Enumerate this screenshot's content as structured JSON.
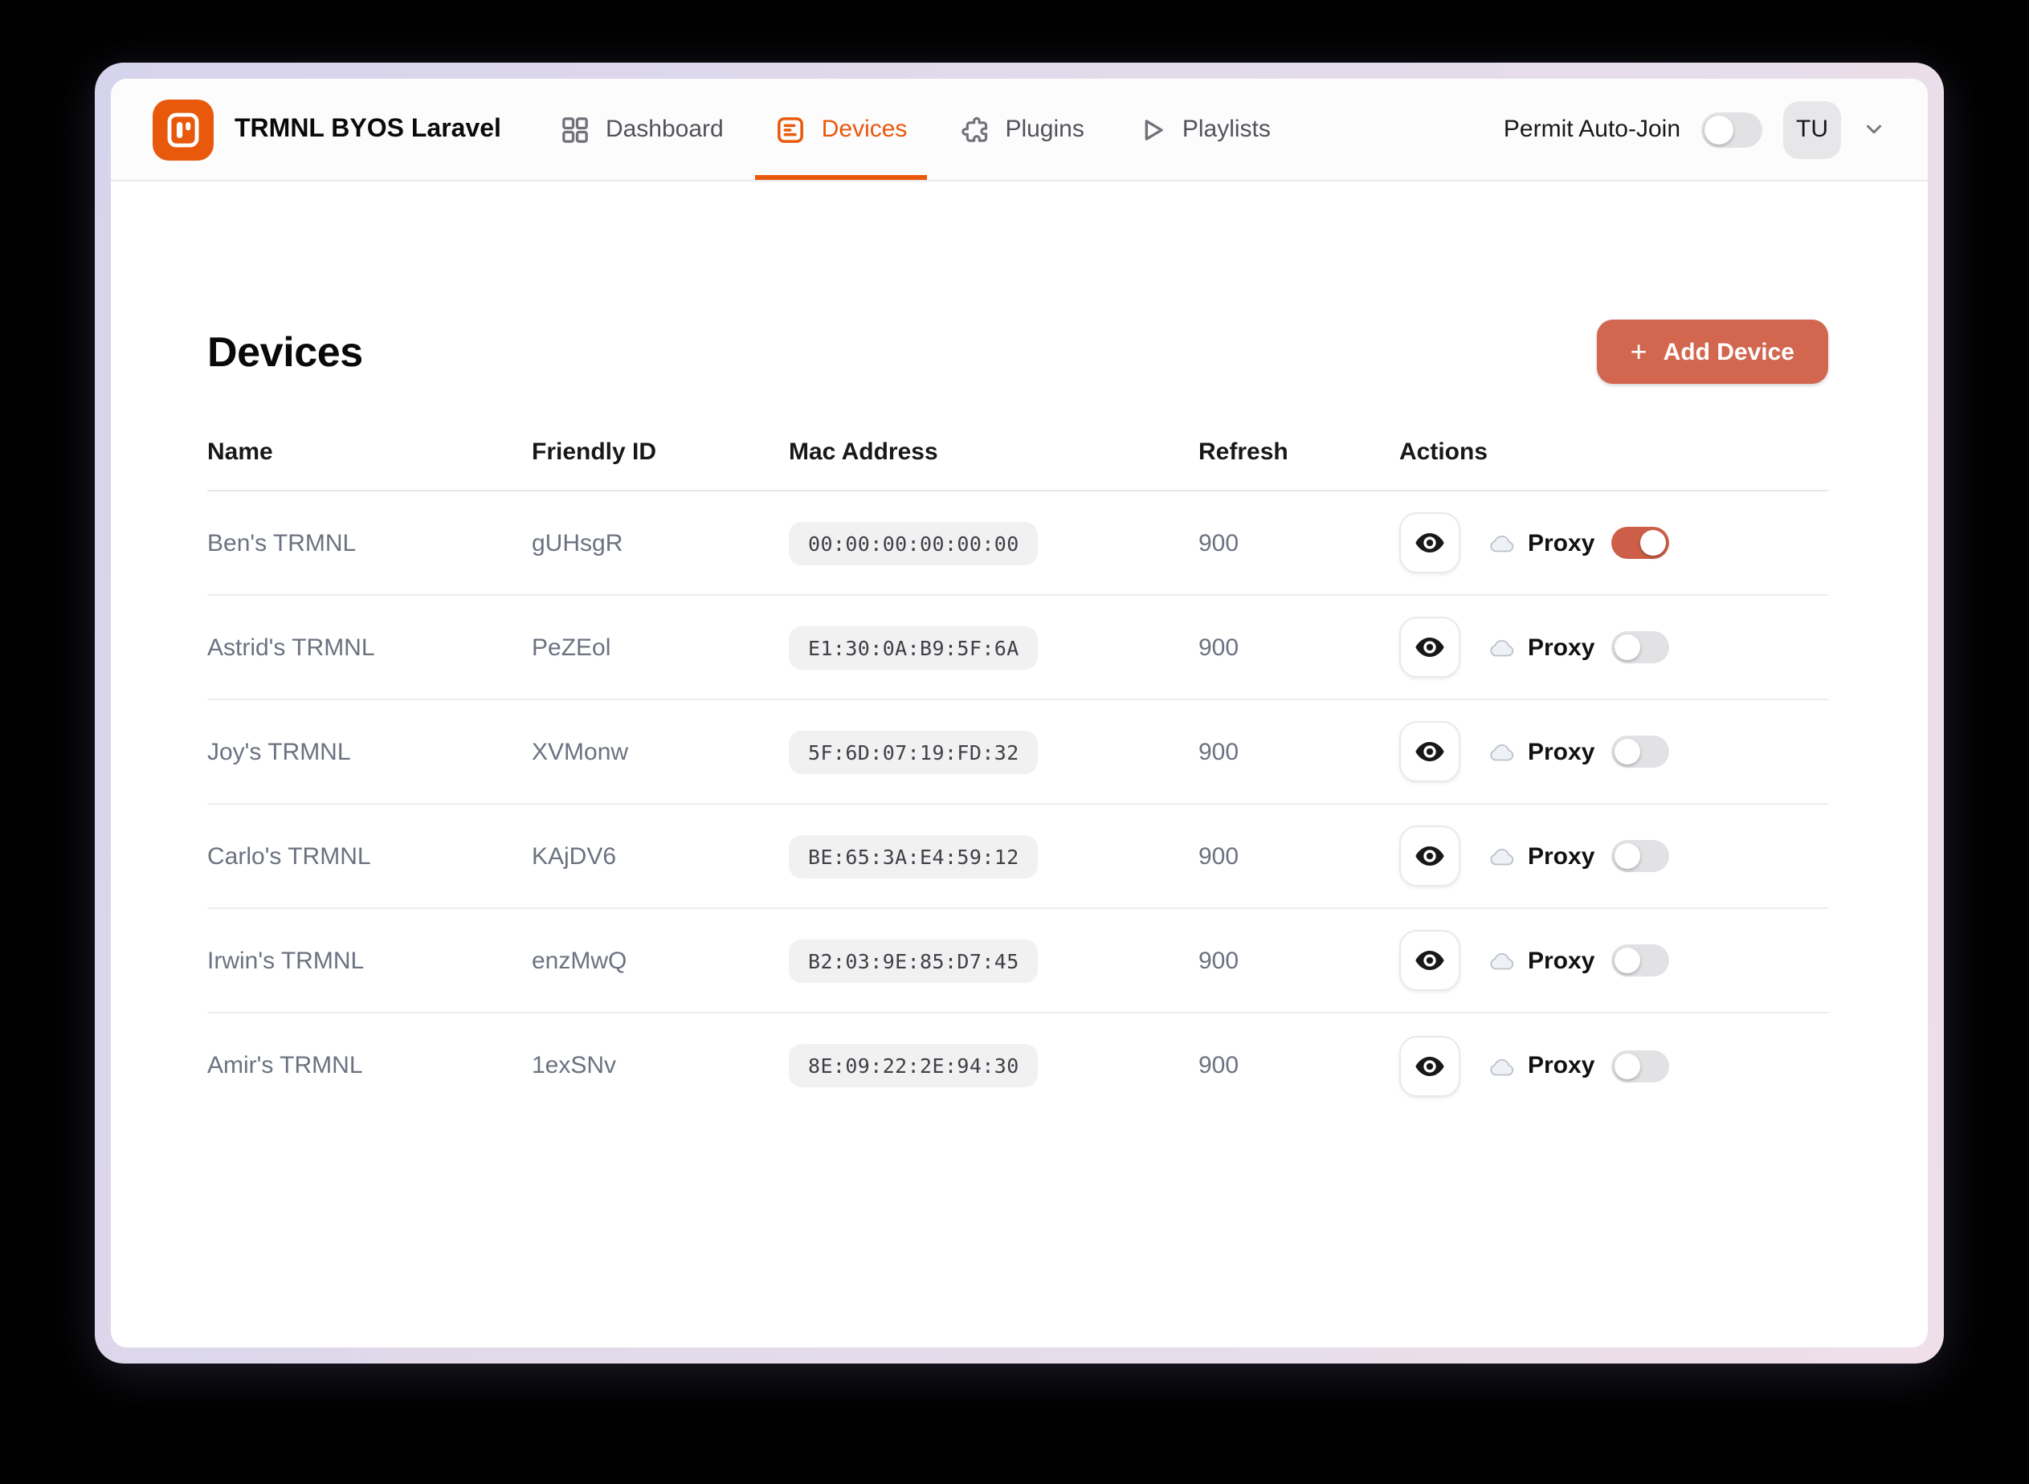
{
  "navbar": {
    "brand": "TRMNL BYOS Laravel",
    "items": [
      {
        "label": "Dashboard",
        "active": false
      },
      {
        "label": "Devices",
        "active": true
      },
      {
        "label": "Plugins",
        "active": false
      },
      {
        "label": "Playlists",
        "active": false
      }
    ],
    "permit_auto_join": {
      "label": "Permit Auto-Join",
      "enabled": false
    },
    "avatar_initials": "TU"
  },
  "page": {
    "title": "Devices",
    "add_button": {
      "plus": "+",
      "label": "Add Device"
    }
  },
  "table": {
    "columns": [
      "Name",
      "Friendly ID",
      "Mac Address",
      "Refresh",
      "Actions"
    ],
    "labels": {
      "proxy": "Proxy"
    },
    "rows": [
      {
        "name": "Ben's TRMNL",
        "friendly_id": "gUHsgR",
        "mac": "00:00:00:00:00:00",
        "refresh": "900",
        "proxy_enabled": true
      },
      {
        "name": "Astrid's TRMNL",
        "friendly_id": "PeZEol",
        "mac": "E1:30:0A:B9:5F:6A",
        "refresh": "900",
        "proxy_enabled": false
      },
      {
        "name": "Joy's TRMNL",
        "friendly_id": "XVMonw",
        "mac": "5F:6D:07:19:FD:32",
        "refresh": "900",
        "proxy_enabled": false
      },
      {
        "name": "Carlo's TRMNL",
        "friendly_id": "KAjDV6",
        "mac": "BE:65:3A:E4:59:12",
        "refresh": "900",
        "proxy_enabled": false
      },
      {
        "name": "Irwin's TRMNL",
        "friendly_id": "enzMwQ",
        "mac": "B2:03:9E:85:D7:45",
        "refresh": "900",
        "proxy_enabled": false
      },
      {
        "name": "Amir's TRMNL",
        "friendly_id": "1exSNv",
        "mac": "8E:09:22:2E:94:30",
        "refresh": "900",
        "proxy_enabled": false
      }
    ]
  },
  "colors": {
    "logo_orange": "#e8590c",
    "active_tab_orange": "#ea580c",
    "button_salmon": "#d2664f",
    "toggle_on_salmon": "#cd5f48",
    "frame_lavender": "#d6d3ec",
    "frame_pink": "#eedfe9"
  }
}
